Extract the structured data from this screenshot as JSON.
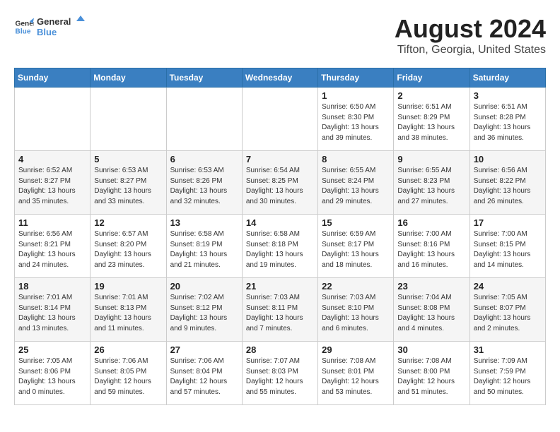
{
  "header": {
    "logo": {
      "line1": "General",
      "line2": "Blue"
    },
    "title": "August 2024",
    "subtitle": "Tifton, Georgia, United States"
  },
  "calendar": {
    "days_of_week": [
      "Sunday",
      "Monday",
      "Tuesday",
      "Wednesday",
      "Thursday",
      "Friday",
      "Saturday"
    ],
    "weeks": [
      [
        {
          "day": "",
          "info": ""
        },
        {
          "day": "",
          "info": ""
        },
        {
          "day": "",
          "info": ""
        },
        {
          "day": "",
          "info": ""
        },
        {
          "day": "1",
          "info": "Sunrise: 6:50 AM\nSunset: 8:30 PM\nDaylight: 13 hours\nand 39 minutes."
        },
        {
          "day": "2",
          "info": "Sunrise: 6:51 AM\nSunset: 8:29 PM\nDaylight: 13 hours\nand 38 minutes."
        },
        {
          "day": "3",
          "info": "Sunrise: 6:51 AM\nSunset: 8:28 PM\nDaylight: 13 hours\nand 36 minutes."
        }
      ],
      [
        {
          "day": "4",
          "info": "Sunrise: 6:52 AM\nSunset: 8:27 PM\nDaylight: 13 hours\nand 35 minutes."
        },
        {
          "day": "5",
          "info": "Sunrise: 6:53 AM\nSunset: 8:27 PM\nDaylight: 13 hours\nand 33 minutes."
        },
        {
          "day": "6",
          "info": "Sunrise: 6:53 AM\nSunset: 8:26 PM\nDaylight: 13 hours\nand 32 minutes."
        },
        {
          "day": "7",
          "info": "Sunrise: 6:54 AM\nSunset: 8:25 PM\nDaylight: 13 hours\nand 30 minutes."
        },
        {
          "day": "8",
          "info": "Sunrise: 6:55 AM\nSunset: 8:24 PM\nDaylight: 13 hours\nand 29 minutes."
        },
        {
          "day": "9",
          "info": "Sunrise: 6:55 AM\nSunset: 8:23 PM\nDaylight: 13 hours\nand 27 minutes."
        },
        {
          "day": "10",
          "info": "Sunrise: 6:56 AM\nSunset: 8:22 PM\nDaylight: 13 hours\nand 26 minutes."
        }
      ],
      [
        {
          "day": "11",
          "info": "Sunrise: 6:56 AM\nSunset: 8:21 PM\nDaylight: 13 hours\nand 24 minutes."
        },
        {
          "day": "12",
          "info": "Sunrise: 6:57 AM\nSunset: 8:20 PM\nDaylight: 13 hours\nand 23 minutes."
        },
        {
          "day": "13",
          "info": "Sunrise: 6:58 AM\nSunset: 8:19 PM\nDaylight: 13 hours\nand 21 minutes."
        },
        {
          "day": "14",
          "info": "Sunrise: 6:58 AM\nSunset: 8:18 PM\nDaylight: 13 hours\nand 19 minutes."
        },
        {
          "day": "15",
          "info": "Sunrise: 6:59 AM\nSunset: 8:17 PM\nDaylight: 13 hours\nand 18 minutes."
        },
        {
          "day": "16",
          "info": "Sunrise: 7:00 AM\nSunset: 8:16 PM\nDaylight: 13 hours\nand 16 minutes."
        },
        {
          "day": "17",
          "info": "Sunrise: 7:00 AM\nSunset: 8:15 PM\nDaylight: 13 hours\nand 14 minutes."
        }
      ],
      [
        {
          "day": "18",
          "info": "Sunrise: 7:01 AM\nSunset: 8:14 PM\nDaylight: 13 hours\nand 13 minutes."
        },
        {
          "day": "19",
          "info": "Sunrise: 7:01 AM\nSunset: 8:13 PM\nDaylight: 13 hours\nand 11 minutes."
        },
        {
          "day": "20",
          "info": "Sunrise: 7:02 AM\nSunset: 8:12 PM\nDaylight: 13 hours\nand 9 minutes."
        },
        {
          "day": "21",
          "info": "Sunrise: 7:03 AM\nSunset: 8:11 PM\nDaylight: 13 hours\nand 7 minutes."
        },
        {
          "day": "22",
          "info": "Sunrise: 7:03 AM\nSunset: 8:10 PM\nDaylight: 13 hours\nand 6 minutes."
        },
        {
          "day": "23",
          "info": "Sunrise: 7:04 AM\nSunset: 8:08 PM\nDaylight: 13 hours\nand 4 minutes."
        },
        {
          "day": "24",
          "info": "Sunrise: 7:05 AM\nSunset: 8:07 PM\nDaylight: 13 hours\nand 2 minutes."
        }
      ],
      [
        {
          "day": "25",
          "info": "Sunrise: 7:05 AM\nSunset: 8:06 PM\nDaylight: 13 hours\nand 0 minutes."
        },
        {
          "day": "26",
          "info": "Sunrise: 7:06 AM\nSunset: 8:05 PM\nDaylight: 12 hours\nand 59 minutes."
        },
        {
          "day": "27",
          "info": "Sunrise: 7:06 AM\nSunset: 8:04 PM\nDaylight: 12 hours\nand 57 minutes."
        },
        {
          "day": "28",
          "info": "Sunrise: 7:07 AM\nSunset: 8:03 PM\nDaylight: 12 hours\nand 55 minutes."
        },
        {
          "day": "29",
          "info": "Sunrise: 7:08 AM\nSunset: 8:01 PM\nDaylight: 12 hours\nand 53 minutes."
        },
        {
          "day": "30",
          "info": "Sunrise: 7:08 AM\nSunset: 8:00 PM\nDaylight: 12 hours\nand 51 minutes."
        },
        {
          "day": "31",
          "info": "Sunrise: 7:09 AM\nSunset: 7:59 PM\nDaylight: 12 hours\nand 50 minutes."
        }
      ]
    ]
  }
}
